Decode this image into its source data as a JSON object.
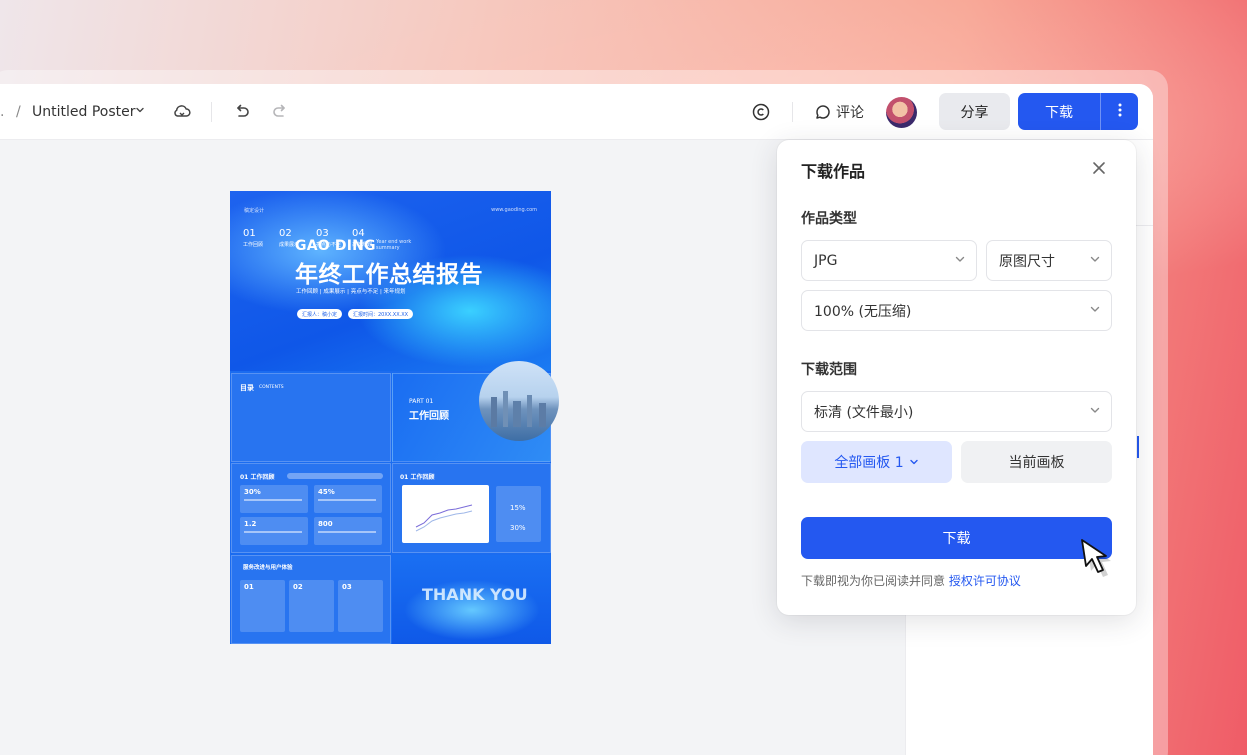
{
  "toolbar": {
    "prev_crumb": ".",
    "crumb_sep": "/",
    "doc_title": "Untitled Poster",
    "comment_label": "评论",
    "share_label": "分享",
    "download_label": "下载"
  },
  "poster": {
    "top_left_small": "稿定设计",
    "top_right_small": "www.gaoding.com",
    "brand": "GAO DING",
    "brand_sub": "Year end work summary",
    "title": "年终工作总结报告",
    "tags": "工作回顾 | 成果展示 | 亮点与不足 | 来年规划",
    "pill_reporter": "汇报人：稿小定",
    "pill_date": "汇报时间：20XX.XX.XX",
    "toc_title": "目录",
    "toc_title_en": "CONTENTS",
    "toc": [
      {
        "num": "01",
        "label": "工作回顾"
      },
      {
        "num": "02",
        "label": "成果展示"
      },
      {
        "num": "03",
        "label": "亮点与不足"
      },
      {
        "num": "04",
        "label": "来年规划"
      }
    ],
    "part_label": "PART 01",
    "part_title": "工作回顾",
    "review1_title": "01 工作回顾",
    "review2_title": "01 工作回顾",
    "stats": [
      "30%",
      "45%",
      "1.2",
      "800"
    ],
    "side_values": [
      "15%",
      "30%"
    ],
    "service_title": "服务改进与用户体验",
    "service_items": [
      "01",
      "02",
      "03"
    ],
    "thanks": "THANK YOU"
  },
  "dialog": {
    "title": "下载作品",
    "type_section": "作品类型",
    "format_value": "JPG",
    "size_value": "原图尺寸",
    "quality_value": "100% (无压缩)",
    "range_section": "下载范围",
    "clarity_value": "标清 (文件最小)",
    "all_boards_label": "全部画板 1",
    "current_board_label": "当前画板",
    "download_button": "下载",
    "agree_text": "下载即视为你已阅读并同意 ",
    "agree_link": "授权许可协议"
  },
  "icons": {
    "dropdown": "chevron-down-icon",
    "cloud": "cloud-sync-icon",
    "undo": "undo-icon",
    "redo": "redo-icon",
    "copyright": "copyright-icon",
    "comment": "comment-icon",
    "more": "more-vertical-icon",
    "close": "close-icon",
    "cursor": "mouse-pointer-icon"
  },
  "colors": {
    "primary": "#2458f0",
    "primary_soft": "#dfe6ff",
    "poster_blue": "#1b6cf0"
  }
}
